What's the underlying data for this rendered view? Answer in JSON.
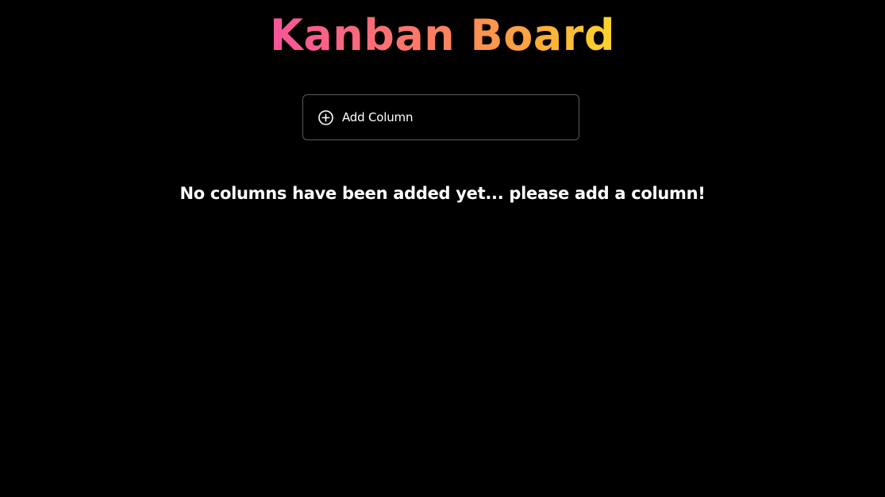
{
  "header": {
    "title": "Kanban Board"
  },
  "toolbar": {
    "add_column_label": "Add Column",
    "add_column_icon": "plus-circle-icon"
  },
  "board": {
    "empty_message": "No columns have been added yet... please add a column!"
  },
  "colors": {
    "background": "#000000",
    "title_gradient_start": "#f7549a",
    "title_gradient_end": "#fbd72b",
    "button_border": "#5a5a5a",
    "text": "#ffffff"
  }
}
